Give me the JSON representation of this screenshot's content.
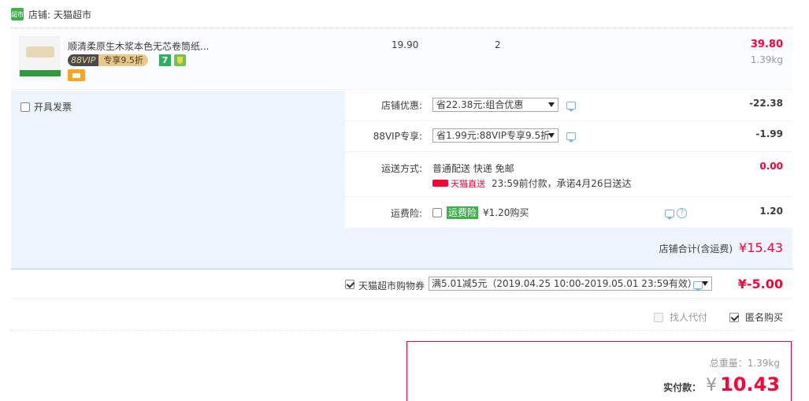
{
  "shop": {
    "icon_text": "超市",
    "prefix": "店铺:",
    "name": "天猫超市"
  },
  "item": {
    "title": "顺清柔原生木浆本色无芯卷筒纸...",
    "thumb_label": "天猫超市",
    "vip_tag": "88VIP",
    "vip_discount": "专享9.5折",
    "badge_7": "7",
    "unit_price": "19.90",
    "quantity": "2",
    "subtotal": "39.80",
    "weight": "1.39kg"
  },
  "invoice": {
    "label": "开具发票",
    "checked": false
  },
  "options": {
    "shop_discount": {
      "label": "店铺优惠:",
      "selected": "省22.38元:组合优惠",
      "value": "-22.38"
    },
    "vip": {
      "label": "88VIP专享:",
      "selected": "省1.99元:88VIP专享9.5折",
      "value": "-1.99"
    },
    "shipping": {
      "label": "运送方式:",
      "method": "普通配送 快递 免邮",
      "tmall_logo": "天猫直送",
      "promise": "23:59前付款，承诺4月26日送达",
      "value": "0.00"
    },
    "freight_insurance": {
      "label": "运费险:",
      "tag": "运费险",
      "price": "¥1.20购买",
      "value": "1.20",
      "help": "?"
    }
  },
  "shop_total": {
    "label": "店铺合计(含运费)",
    "amount": "¥15.43"
  },
  "coupon": {
    "label": "天猫超市购物券",
    "selected": "满5.01减5元（2019.04.25 10:00-2019.05.01 23:59有效）",
    "value": "¥-5.00",
    "checked": true
  },
  "agent_pay": {
    "label": "找人代付",
    "checked": false,
    "disabled": true
  },
  "anonymous": {
    "label": "匿名购买",
    "checked": true
  },
  "payment": {
    "total_weight": "总重量：1.39kg",
    "label": "实付款：",
    "currency": "¥",
    "amount": "10.43"
  },
  "colors": {
    "accent": "#ff0036",
    "panel_bg": "#eef4fd",
    "link_blue": "#7bb2e3",
    "tmall_green": "#3fb04d"
  }
}
